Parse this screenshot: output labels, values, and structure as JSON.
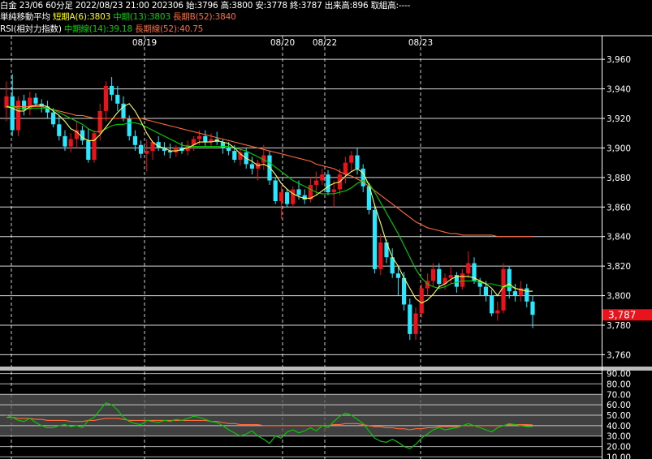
{
  "header": {
    "symbol": "白金 23/06 60分足",
    "datetime": "2022/08/23 21:00",
    "contract": "202306",
    "open_label": "始:",
    "open": "3796",
    "high_label": "高:",
    "high": "3800",
    "low_label": "安:",
    "low": "3778",
    "close_label": "終:",
    "close": "3787",
    "volume_label": "出来高:",
    "volume": "896",
    "oi_label": "取組高:",
    "oi": "----",
    "ma_title": "単純移動平均",
    "ma_short": "短期A(6):3803",
    "ma_mid": "中期(13):3803",
    "ma_long": "長期B(52):3840",
    "rsi_title": "RSI(相対力指数)",
    "rsi_mid": "中期線(14):39.18",
    "rsi_long": "長期線(52):40.75"
  },
  "colors": {
    "up": "#e8131b",
    "down": "#29e8ff",
    "ma_short": "#ffff66",
    "ma_mid": "#00d000",
    "ma_long": "#ff6a3d",
    "grid": "#ffffff",
    "price_tag_bg": "#e8131b",
    "rsi_band": "#555555"
  },
  "chart_data": [
    {
      "type": "candlestick",
      "title": "",
      "x_labels": [
        "08/19",
        "08/20",
        "08/22",
        "08/23"
      ],
      "y_ticks": [
        3760,
        3780,
        3800,
        3820,
        3840,
        3860,
        3880,
        3900,
        3920,
        3940,
        3960
      ],
      "ylim": [
        3752,
        3976
      ],
      "grid": true,
      "last_price": 3787,
      "last_price_label": "3,787",
      "candles": [
        [
          3927,
          3945,
          3918,
          3935
        ],
        [
          3935,
          3950,
          3908,
          3912
        ],
        [
          3912,
          3935,
          3908,
          3932
        ],
        [
          3932,
          3936,
          3922,
          3926
        ],
        [
          3926,
          3938,
          3922,
          3934
        ],
        [
          3934,
          3937,
          3928,
          3930
        ],
        [
          3930,
          3933,
          3924,
          3928
        ],
        [
          3928,
          3932,
          3920,
          3924
        ],
        [
          3924,
          3927,
          3914,
          3916
        ],
        [
          3916,
          3922,
          3905,
          3908
        ],
        [
          3908,
          3912,
          3898,
          3901
        ],
        [
          3901,
          3910,
          3897,
          3906
        ],
        [
          3906,
          3918,
          3900,
          3912
        ],
        [
          3912,
          3915,
          3902,
          3905
        ],
        [
          3905,
          3913,
          3890,
          3892
        ],
        [
          3892,
          3912,
          3890,
          3910
        ],
        [
          3910,
          3930,
          3905,
          3925
        ],
        [
          3925,
          3945,
          3918,
          3942
        ],
        [
          3942,
          3948,
          3932,
          3936
        ],
        [
          3936,
          3942,
          3925,
          3930
        ],
        [
          3930,
          3935,
          3918,
          3920
        ],
        [
          3920,
          3922,
          3905,
          3908
        ],
        [
          3908,
          3912,
          3898,
          3902
        ],
        [
          3902,
          3905,
          3893,
          3896
        ],
        [
          3896,
          3906,
          3884,
          3898
        ],
        [
          3898,
          3905,
          3892,
          3904
        ],
        [
          3904,
          3908,
          3898,
          3900
        ],
        [
          3900,
          3904,
          3895,
          3898
        ],
        [
          3898,
          3903,
          3893,
          3897
        ],
        [
          3897,
          3902,
          3894,
          3900
        ],
        [
          3900,
          3904,
          3896,
          3898
        ],
        [
          3898,
          3905,
          3895,
          3902
        ],
        [
          3902,
          3908,
          3898,
          3906
        ],
        [
          3906,
          3912,
          3902,
          3908
        ],
        [
          3908,
          3912,
          3901,
          3904
        ],
        [
          3904,
          3910,
          3900,
          3906
        ],
        [
          3906,
          3911,
          3902,
          3904
        ],
        [
          3904,
          3906,
          3896,
          3900
        ],
        [
          3900,
          3904,
          3895,
          3898
        ],
        [
          3898,
          3902,
          3890,
          3892
        ],
        [
          3892,
          3900,
          3888,
          3897
        ],
        [
          3897,
          3900,
          3886,
          3889
        ],
        [
          3889,
          3894,
          3882,
          3886
        ],
        [
          3886,
          3892,
          3878,
          3890
        ],
        [
          3890,
          3902,
          3885,
          3895
        ],
        [
          3895,
          3898,
          3875,
          3878
        ],
        [
          3878,
          3880,
          3862,
          3864
        ],
        [
          3864,
          3874,
          3852,
          3870
        ],
        [
          3870,
          3872,
          3860,
          3862
        ],
        [
          3862,
          3874,
          3860,
          3872
        ],
        [
          3872,
          3878,
          3865,
          3868
        ],
        [
          3868,
          3872,
          3862,
          3865
        ],
        [
          3865,
          3880,
          3863,
          3875
        ],
        [
          3875,
          3884,
          3868,
          3878
        ],
        [
          3878,
          3886,
          3875,
          3882
        ],
        [
          3882,
          3885,
          3868,
          3870
        ],
        [
          3870,
          3878,
          3860,
          3872
        ],
        [
          3872,
          3886,
          3868,
          3882
        ],
        [
          3882,
          3894,
          3876,
          3890
        ],
        [
          3890,
          3898,
          3884,
          3895
        ],
        [
          3895,
          3900,
          3882,
          3886
        ],
        [
          3886,
          3889,
          3870,
          3874
        ],
        [
          3874,
          3876,
          3855,
          3858
        ],
        [
          3858,
          3862,
          3815,
          3818
        ],
        [
          3818,
          3842,
          3814,
          3836
        ],
        [
          3836,
          3838,
          3822,
          3826
        ],
        [
          3826,
          3832,
          3812,
          3815
        ],
        [
          3815,
          3820,
          3800,
          3812
        ],
        [
          3812,
          3816,
          3790,
          3794
        ],
        [
          3794,
          3798,
          3770,
          3774
        ],
        [
          3774,
          3792,
          3770,
          3788
        ],
        [
          3788,
          3808,
          3785,
          3805
        ],
        [
          3805,
          3815,
          3800,
          3810
        ],
        [
          3810,
          3822,
          3806,
          3818
        ],
        [
          3818,
          3822,
          3805,
          3808
        ],
        [
          3808,
          3815,
          3804,
          3812
        ],
        [
          3812,
          3820,
          3808,
          3814
        ],
        [
          3814,
          3816,
          3802,
          3806
        ],
        [
          3806,
          3818,
          3804,
          3815
        ],
        [
          3815,
          3830,
          3812,
          3822
        ],
        [
          3822,
          3826,
          3808,
          3810
        ],
        [
          3810,
          3812,
          3800,
          3806
        ],
        [
          3806,
          3810,
          3796,
          3800
        ],
        [
          3800,
          3804,
          3786,
          3788
        ],
        [
          3788,
          3796,
          3783,
          3790
        ],
        [
          3790,
          3822,
          3788,
          3818
        ],
        [
          3818,
          3820,
          3798,
          3803
        ],
        [
          3803,
          3808,
          3796,
          3800
        ],
        [
          3800,
          3810,
          3796,
          3805
        ],
        [
          3805,
          3808,
          3792,
          3796
        ],
        [
          3796,
          3800,
          3778,
          3787
        ]
      ],
      "ma_short": [
        3928,
        3927,
        3925,
        3925,
        3928,
        3929,
        3929,
        3928,
        3925,
        3922,
        3918,
        3913,
        3911,
        3907,
        3905,
        3905,
        3909,
        3914,
        3919,
        3924,
        3928,
        3930,
        3925,
        3918,
        3910,
        3904,
        3901,
        3900,
        3898,
        3898,
        3899,
        3900,
        3902,
        3904,
        3904,
        3904,
        3905,
        3904,
        3903,
        3900,
        3896,
        3893,
        3891,
        3888,
        3889,
        3887,
        3882,
        3876,
        3872,
        3869,
        3867,
        3866,
        3866,
        3868,
        3871,
        3874,
        3876,
        3877,
        3881,
        3884,
        3886,
        3883,
        3875,
        3861,
        3849,
        3836,
        3826,
        3820,
        3812,
        3805,
        3798,
        3795,
        3797,
        3801,
        3806,
        3808,
        3811,
        3813,
        3813,
        3813,
        3812,
        3810,
        3808,
        3805,
        3800,
        3806,
        3808,
        3805,
        3804,
        3803,
        3803
      ],
      "ma_mid": [
        3928,
        3928,
        3927,
        3927,
        3927,
        3927,
        3927,
        3927,
        3926,
        3924,
        3922,
        3920,
        3918,
        3916,
        3913,
        3911,
        3911,
        3913,
        3915,
        3916,
        3916,
        3917,
        3917,
        3916,
        3914,
        3912,
        3910,
        3908,
        3906,
        3904,
        3902,
        3901,
        3901,
        3901,
        3901,
        3901,
        3901,
        3901,
        3901,
        3900,
        3899,
        3898,
        3896,
        3894,
        3892,
        3890,
        3887,
        3884,
        3881,
        3878,
        3876,
        3874,
        3872,
        3870,
        3869,
        3869,
        3869,
        3870,
        3871,
        3873,
        3876,
        3878,
        3876,
        3870,
        3863,
        3856,
        3849,
        3842,
        3834,
        3826,
        3818,
        3812,
        3808,
        3806,
        3805,
        3806,
        3808,
        3809,
        3810,
        3810,
        3810,
        3809,
        3808,
        3808,
        3807,
        3806,
        3806,
        3805,
        3804,
        3803,
        3803
      ],
      "ma_long": [
        3928,
        3928,
        3928,
        3928,
        3928,
        3928,
        3928,
        3927,
        3926,
        3925,
        3924,
        3923,
        3922,
        3922,
        3921,
        3920,
        3920,
        3920,
        3920,
        3920,
        3920,
        3920,
        3920,
        3920,
        3919,
        3918,
        3917,
        3916,
        3915,
        3914,
        3913,
        3912,
        3911,
        3910,
        3909,
        3908,
        3907,
        3906,
        3905,
        3904,
        3903,
        3902,
        3901,
        3900,
        3899,
        3898,
        3897,
        3896,
        3895,
        3894,
        3893,
        3892,
        3891,
        3889,
        3888,
        3887,
        3886,
        3884,
        3882,
        3881,
        3879,
        3877,
        3874,
        3871,
        3868,
        3865,
        3862,
        3859,
        3856,
        3853,
        3850,
        3848,
        3846,
        3845,
        3844,
        3843,
        3842,
        3842,
        3841,
        3841,
        3841,
        3841,
        3841,
        3841,
        3840,
        3840,
        3840,
        3840,
        3840,
        3840,
        3840
      ]
    },
    {
      "type": "line",
      "title": "",
      "y_ticks": [
        10,
        20,
        30,
        40,
        50,
        60,
        70,
        80,
        90
      ],
      "y_tick_labels": [
        "10.00",
        "20.00",
        "30.00",
        "40.00",
        "50.00",
        "60.00",
        "70.00",
        "80.00",
        "90.00"
      ],
      "ylim": [
        8,
        92
      ],
      "bands": [
        [
          30,
          70
        ]
      ],
      "rsi_mid": [
        50,
        48,
        45,
        44,
        47,
        43,
        40,
        38,
        38,
        40,
        41,
        39,
        40,
        38,
        45,
        48,
        55,
        62,
        60,
        55,
        48,
        44,
        42,
        41,
        45,
        44,
        43,
        45,
        44,
        46,
        45,
        47,
        49,
        48,
        46,
        44,
        43,
        40,
        36,
        33,
        30,
        32,
        35,
        30,
        27,
        23,
        30,
        28,
        34,
        36,
        33,
        35,
        38,
        35,
        40,
        38,
        44,
        49,
        52,
        50,
        46,
        42,
        35,
        28,
        25,
        24,
        27,
        24,
        20,
        18,
        22,
        28,
        32,
        36,
        38,
        36,
        37,
        38,
        40,
        42,
        40,
        38,
        36,
        34,
        38,
        40,
        42,
        41,
        40,
        39,
        39.18
      ],
      "rsi_long": [
        48,
        48,
        47,
        47,
        47,
        46,
        46,
        45,
        45,
        45,
        45,
        44,
        44,
        44,
        45,
        45,
        46,
        47,
        47,
        47,
        46,
        45,
        45,
        45,
        45,
        45,
        45,
        45,
        45,
        45,
        45,
        45,
        45,
        45,
        45,
        44,
        44,
        43,
        42,
        42,
        41,
        41,
        41,
        41,
        40,
        40,
        40,
        40,
        40,
        40,
        40,
        40,
        40,
        40,
        40,
        40,
        41,
        41,
        42,
        42,
        42,
        41,
        40,
        39,
        39,
        38,
        38,
        37,
        37,
        36,
        37,
        37,
        38,
        38,
        39,
        39,
        39,
        39,
        40,
        40,
        40,
        40,
        40,
        40,
        40,
        40,
        41,
        41,
        41,
        41,
        40.75
      ]
    }
  ]
}
